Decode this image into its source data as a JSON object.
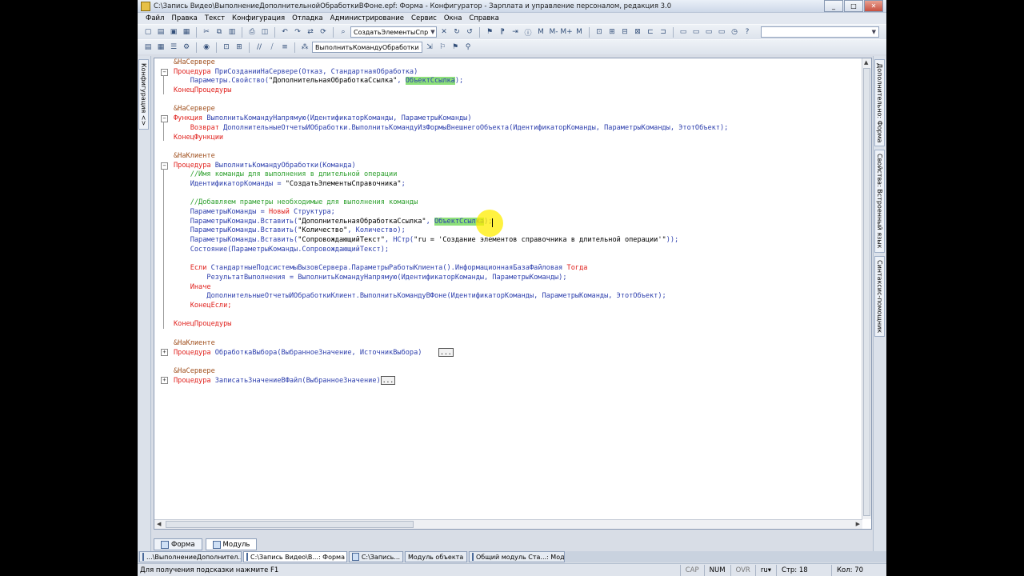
{
  "window": {
    "title": "C:\\Запись Видео\\ВыполнениеДополнительнойОбработкиВФоне.epf: Форма - Конфигуратор - Зарплата и управление персоналом, редакция 3.0",
    "minimize": "_",
    "maximize": "□",
    "close": "✕"
  },
  "menu": [
    "Файл",
    "Правка",
    "Текст",
    "Конфигурация",
    "Отладка",
    "Администрирование",
    "Сервис",
    "Окна",
    "Справка"
  ],
  "toolbar": {
    "search_combo": "СоздатьЭлементыСпр",
    "procedure_combo": "ВыполнитьКомандуОбработки",
    "mlabels": [
      "M",
      "M-",
      "M+",
      "M"
    ]
  },
  "left_panel": {
    "tab": "Конфигурация <>"
  },
  "right_panel": {
    "tabs": [
      "Дополнительно: Форма",
      "Свойства: Встроенный язык",
      "Синтаксис-помощник"
    ]
  },
  "code": {
    "l1": "&НаСервере",
    "l2_kw": "Процедура",
    "l2_rest": " ПриСозданииНаСервере(Отказ, СтандартнаяОбработка)",
    "l3_a": "    Параметры.Свойство(",
    "l3_str": "\"ДополнительнаяОбработкаСсылка\"",
    "l3_b": ", ",
    "l3_hl": "ОбъектСсылка",
    "l3_c": ");",
    "l4": "КонецПроцедуры",
    "l6": "&НаСервере",
    "l7_kw": "Функция",
    "l7_rest": " ВыполнитьКомандуНапрямую(ИдентификаторКоманды, ПараметрыКоманды)",
    "l8_kw": "    Возврат",
    "l8_rest": " ДополнительныеОтчетыИОбработки.ВыполнитьКомандуИзФормыВнешнегоОбъекта(ИдентификаторКоманды, ПараметрыКоманды, ЭтотОбъект);",
    "l9": "КонецФункции",
    "l11": "&НаКлиенте",
    "l12_kw": "Процедура",
    "l12_rest": " ВыполнитьКомандуОбработки(Команда)",
    "l13": "    //Имя команды для выполнения в длительной операции",
    "l14_a": "    ИдентификаторКоманды = ",
    "l14_str": "\"СоздатьЭлементыСправочника\"",
    "l14_b": ";",
    "l16": "    //Добавляем праметры необходимые для выполнения команды",
    "l17_a": "    ПараметрыКоманды = ",
    "l17_kw": "Новый",
    "l17_b": " Структура;",
    "l18_a": "    ПараметрыКоманды.Вставить(",
    "l18_str": "\"ДополнительнаяОбработкаСсылка\"",
    "l18_b": ", ",
    "l18_hl": "ОбъектСсылка",
    "l18_c": ");",
    "l19_a": "    ПараметрыКоманды.Вставить(",
    "l19_str": "\"Количество\"",
    "l19_b": ", Количество);",
    "l20_a": "    ПараметрыКоманды.Вставить(",
    "l20_str": "\"СопровождающийТекст\"",
    "l20_b": ", НСтр(",
    "l20_str2": "\"ru = 'Создание элементов справочника в длительной операции'\"",
    "l20_c": "));",
    "l21": "    Состояние(ПараметрыКоманды.СопровождающийТекст);",
    "l23_kw": "    Если",
    "l23_rest": " СтандартныеПодсистемыВызовСервера.ПараметрыРаботыКлиента().ИнформационнаяБазаФайловая ",
    "l23_kw2": "Тогда",
    "l24": "        РезультатВыполнения = ВыполнитьКомандуНапрямую(ИдентификаторКоманды, ПараметрыКоманды);",
    "l25": "    Иначе",
    "l26": "        ДополнительныеОтчетыИОбработкиКлиент.ВыполнитьКомандуВФоне(ИдентификаторКоманды, ПараметрыКоманды, ЭтотОбъект);",
    "l27": "    КонецЕсли;",
    "l29": "КонецПроцедуры",
    "l31": "&НаКлиенте",
    "l32_kw": "Процедура",
    "l32_rest": " ОбработкаВыбора(ВыбранноеЗначение, ИсточникВыбора)",
    "l34": "&НаСервере",
    "l35_kw": "Процедура",
    "l35_rest": " ЗаписатьЗначениеВФайл(ВыбранноеЗначение)",
    "ellipsis": "..."
  },
  "bottom_tabs": [
    "Форма",
    "Модуль"
  ],
  "taskbar": [
    "...\\ВыполнениеДополнител...",
    "C:\\Запись Видео\\В...: Форма",
    "C:\\Запись...",
    "Модуль объекта",
    "Общий модуль Ста...: Модуль"
  ],
  "status": {
    "hint": "Для получения подсказки нажмите F1",
    "cap": "CAP",
    "num": "NUM",
    "ovr": "OVR",
    "lang": "ru",
    "line": "Стр: 18",
    "col": "Кол: 70"
  }
}
